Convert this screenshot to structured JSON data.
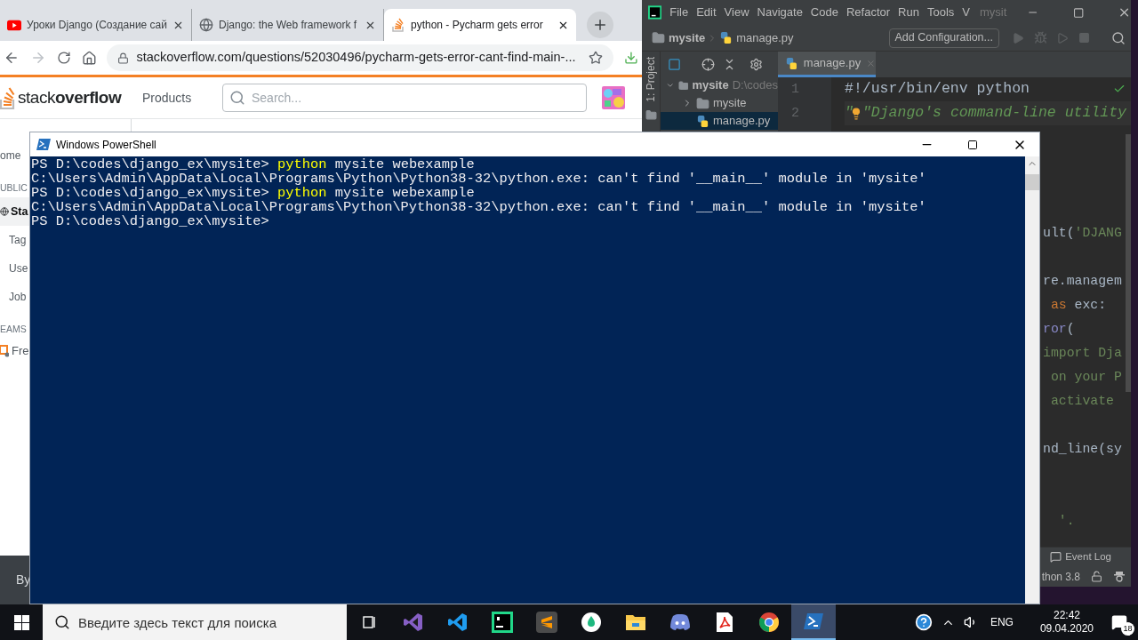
{
  "browser": {
    "tabs": [
      {
        "title": "Уроки Django (Создание сай",
        "kind": "video",
        "selected": false
      },
      {
        "title": "Django: the Web framework f",
        "kind": "globe",
        "selected": false
      },
      {
        "title": "python - Pycharm gets error",
        "kind": "stack",
        "selected": true
      }
    ],
    "url": "stackoverflow.com/questions/52030496/pycharm-gets-error-cant-find-main-...",
    "site": {
      "logo": "stack**overflow**",
      "nav": "Products",
      "search_placeholder": "Search..."
    },
    "sidebar": [
      {
        "text": "ome",
        "kind": "link"
      },
      {
        "text": "UBLIC",
        "kind": "heading"
      },
      {
        "text": "Sta",
        "kind": "current"
      },
      {
        "text": "Tag",
        "kind": "link"
      },
      {
        "text": "Use",
        "kind": "link"
      },
      {
        "text": "Job",
        "kind": "link"
      },
      {
        "text": "EAMS",
        "kind": "heading"
      },
      {
        "text": "Fre",
        "kind": "teams"
      }
    ],
    "footer": "By"
  },
  "pycharm": {
    "menu": [
      "File",
      "Edit",
      "View",
      "Navigate",
      "Code",
      "Refactor",
      "Run",
      "Tools",
      "V"
    ],
    "title": "mysit",
    "breadcrumb": [
      "mysite",
      "manage.py"
    ],
    "run_config": "Add Configuration...",
    "project_tab": "1: Project",
    "tree": [
      {
        "name": "mysite",
        "path": "D:\\codes",
        "kind": "folder",
        "expanded": true,
        "selected": false,
        "children": [
          {
            "name": "mysite",
            "kind": "folder",
            "expanded": false,
            "selected": false
          },
          {
            "name": "manage.py",
            "kind": "python",
            "selected": true
          }
        ]
      }
    ],
    "editor_tab": "manage.py",
    "lines": [
      {
        "number": "1",
        "hint": false,
        "segments": [
          {
            "text": "#!/usr/bin/env python",
            "kind": "plain"
          }
        ]
      },
      {
        "number": "2",
        "hint": true,
        "segments": [
          {
            "text": "\"",
            "kind": "docstring"
          },
          {
            "text": "\"Django's command-line utility",
            "kind": "docstring"
          }
        ]
      }
    ],
    "partial_lines": [
      {
        "segments": [
          {
            "text": "ult(",
            "kind": "plain"
          },
          {
            "text": "'DJANG",
            "kind": "string"
          }
        ]
      },
      {
        "segments": [
          {
            "text": "re.managem",
            "kind": "plain"
          }
        ]
      },
      {
        "segments": [
          {
            "text": " as",
            "kind": "keyword"
          },
          {
            "text": " exc:",
            "kind": "plain"
          }
        ]
      },
      {
        "segments": [
          {
            "text": "ror",
            "kind": "builtin"
          },
          {
            "text": "(",
            "kind": "plain"
          }
        ]
      },
      {
        "segments": [
          {
            "text": "import Dja",
            "kind": "string"
          }
        ]
      },
      {
        "segments": [
          {
            "text": " on your P",
            "kind": "string"
          }
        ]
      },
      {
        "segments": [
          {
            "text": " activate",
            "kind": "string"
          }
        ]
      },
      {
        "segments": [
          {
            "text": "nd_line(sy",
            "kind": "plain"
          }
        ]
      },
      {
        "segments": [
          {
            "text": "  '.",
            "kind": "string"
          }
        ]
      }
    ],
    "event_log": "Event Log",
    "interpreter": "thon 3.8"
  },
  "powershell": {
    "title": "Windows PowerShell",
    "lines": [
      {
        "kind": "prompt",
        "prompt": "PS D:\\codes\\django_ex\\mysite>",
        "command": "python",
        "args": "mysite webexample"
      },
      {
        "kind": "output",
        "text": "C:\\Users\\Admin\\AppData\\Local\\Programs\\Python\\Python38-32\\python.exe: can't find '__main__' module in 'mysite'"
      },
      {
        "kind": "prompt",
        "prompt": "PS D:\\codes\\django_ex\\mysite>",
        "command": "python",
        "args": "mysite webexample"
      },
      {
        "kind": "output",
        "text": "C:\\Users\\Admin\\AppData\\Local\\Programs\\Python\\Python38-32\\python.exe: can't find '__main__' module in 'mysite'"
      },
      {
        "kind": "prompt",
        "prompt": "PS D:\\codes\\django_ex\\mysite>"
      }
    ]
  },
  "taskbar": {
    "search_placeholder": "Введите здесь текст для поиска",
    "apps": [
      {
        "kind": "taskview",
        "selected": false
      },
      {
        "kind": "vs",
        "selected": false
      },
      {
        "kind": "vscode",
        "selected": false
      },
      {
        "kind": "pycharm",
        "selected": false
      },
      {
        "kind": "sublime",
        "selected": false
      },
      {
        "kind": "drop",
        "selected": false
      },
      {
        "kind": "explorer",
        "selected": false
      },
      {
        "kind": "discord",
        "selected": false
      },
      {
        "kind": "pdf",
        "selected": false
      },
      {
        "kind": "chrome",
        "selected": false
      },
      {
        "kind": "powershell",
        "selected": true
      }
    ],
    "language": "ENG",
    "time": "22:42",
    "date": "09.04.2020",
    "notifications": "18"
  }
}
